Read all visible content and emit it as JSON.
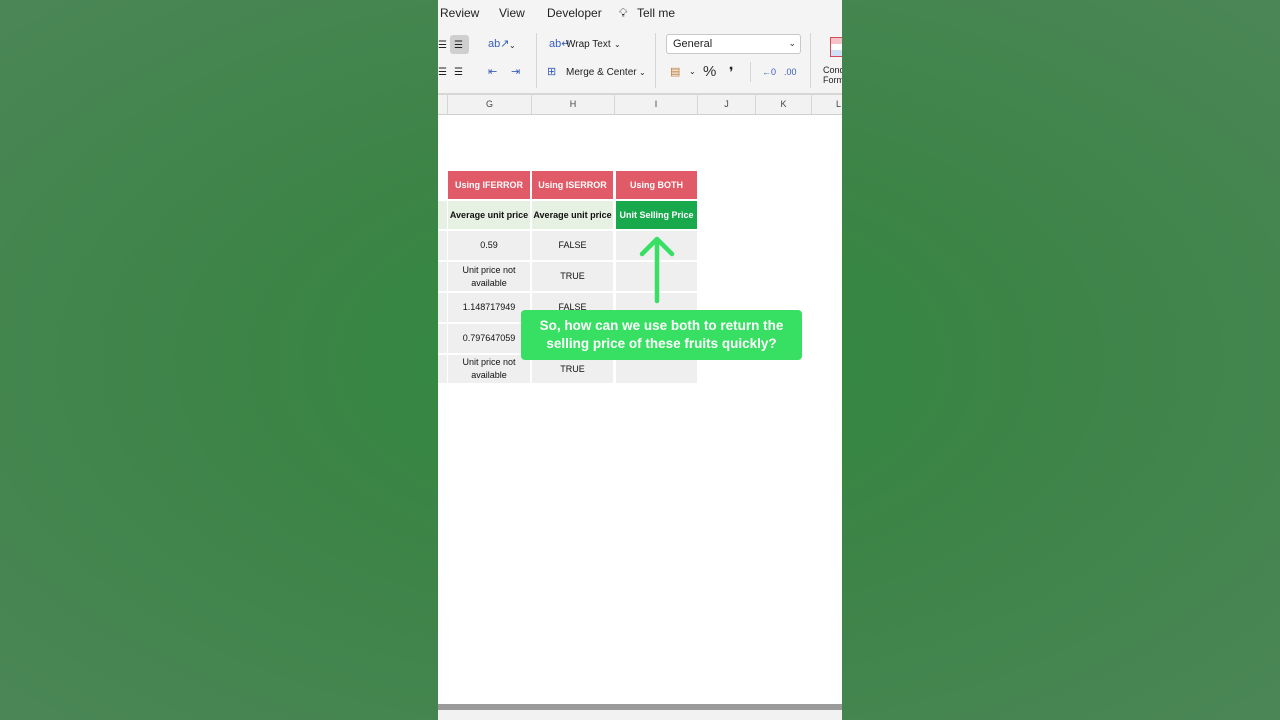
{
  "menu": {
    "review": "Review",
    "view": "View",
    "developer": "Developer",
    "tell_me": "Tell me"
  },
  "toolbar": {
    "wrap_text": "Wrap Text",
    "merge_center": "Merge & Center",
    "number_format": "General",
    "percent": "%",
    "comma": "❜",
    "conditional_formatting_line1": "Cond",
    "conditional_formatting_line2": "Form"
  },
  "columns": [
    "G",
    "H",
    "I",
    "J",
    "K",
    "L"
  ],
  "table": {
    "headers": [
      "Using IFERROR",
      "Using ISERROR",
      "Using BOTH"
    ],
    "subheaders": [
      "Average unit price",
      "Average unit price",
      "Unit Selling Price"
    ],
    "rows": [
      [
        "0.59",
        "FALSE",
        ""
      ],
      [
        "Unit price not available",
        "TRUE",
        ""
      ],
      [
        "1.148717949",
        "FALSE",
        ""
      ],
      [
        "0.797647059",
        "",
        ""
      ],
      [
        "Unit price not available",
        "TRUE",
        ""
      ]
    ]
  },
  "callout": {
    "text": "So, how can we use both to return the selling price of these fruits quickly?"
  },
  "colors": {
    "header_red": "#e05a67",
    "subheader_green": "#17a94b",
    "callout_green": "#37df63",
    "background_green": "#3d8447"
  }
}
